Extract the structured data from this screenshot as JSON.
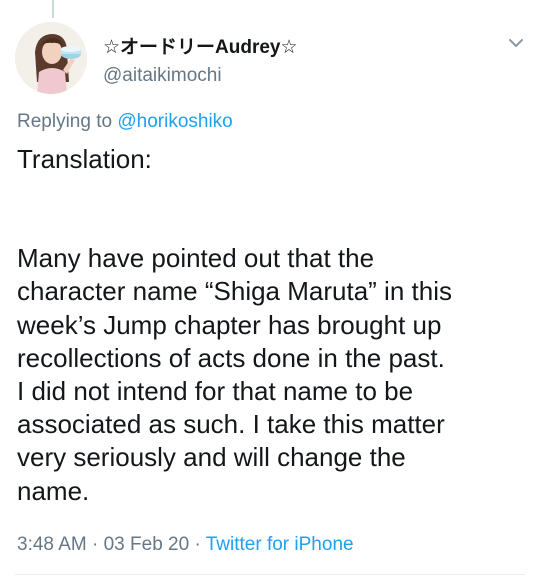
{
  "tweet": {
    "display_name": "☆オードリーAudrey☆",
    "handle": "@aitaikimochi",
    "replying_prefix": "Replying to ",
    "replying_to": "@horikoshiko",
    "body_title": "Translation:",
    "body_lines": [
      "Many have pointed out that the",
      "character name “Shiga Maruta” in this",
      "week’s Jump chapter has brought up",
      "recollections of acts done in the past.",
      "I did not intend for that name to be",
      "associated as such. I take this matter",
      "very seriously and will change the",
      "name."
    ],
    "time": "3:48 AM",
    "sep1": " · ",
    "date": "03 Feb 20",
    "sep2": " · ",
    "source": "Twitter for iPhone"
  },
  "icons": {
    "menu": "chevron-down-icon",
    "avatar": "avatar-photo"
  },
  "colors": {
    "text_primary": "#14171a",
    "text_secondary": "#657786",
    "link": "#1da1f2",
    "divider": "#e6ecf0"
  }
}
